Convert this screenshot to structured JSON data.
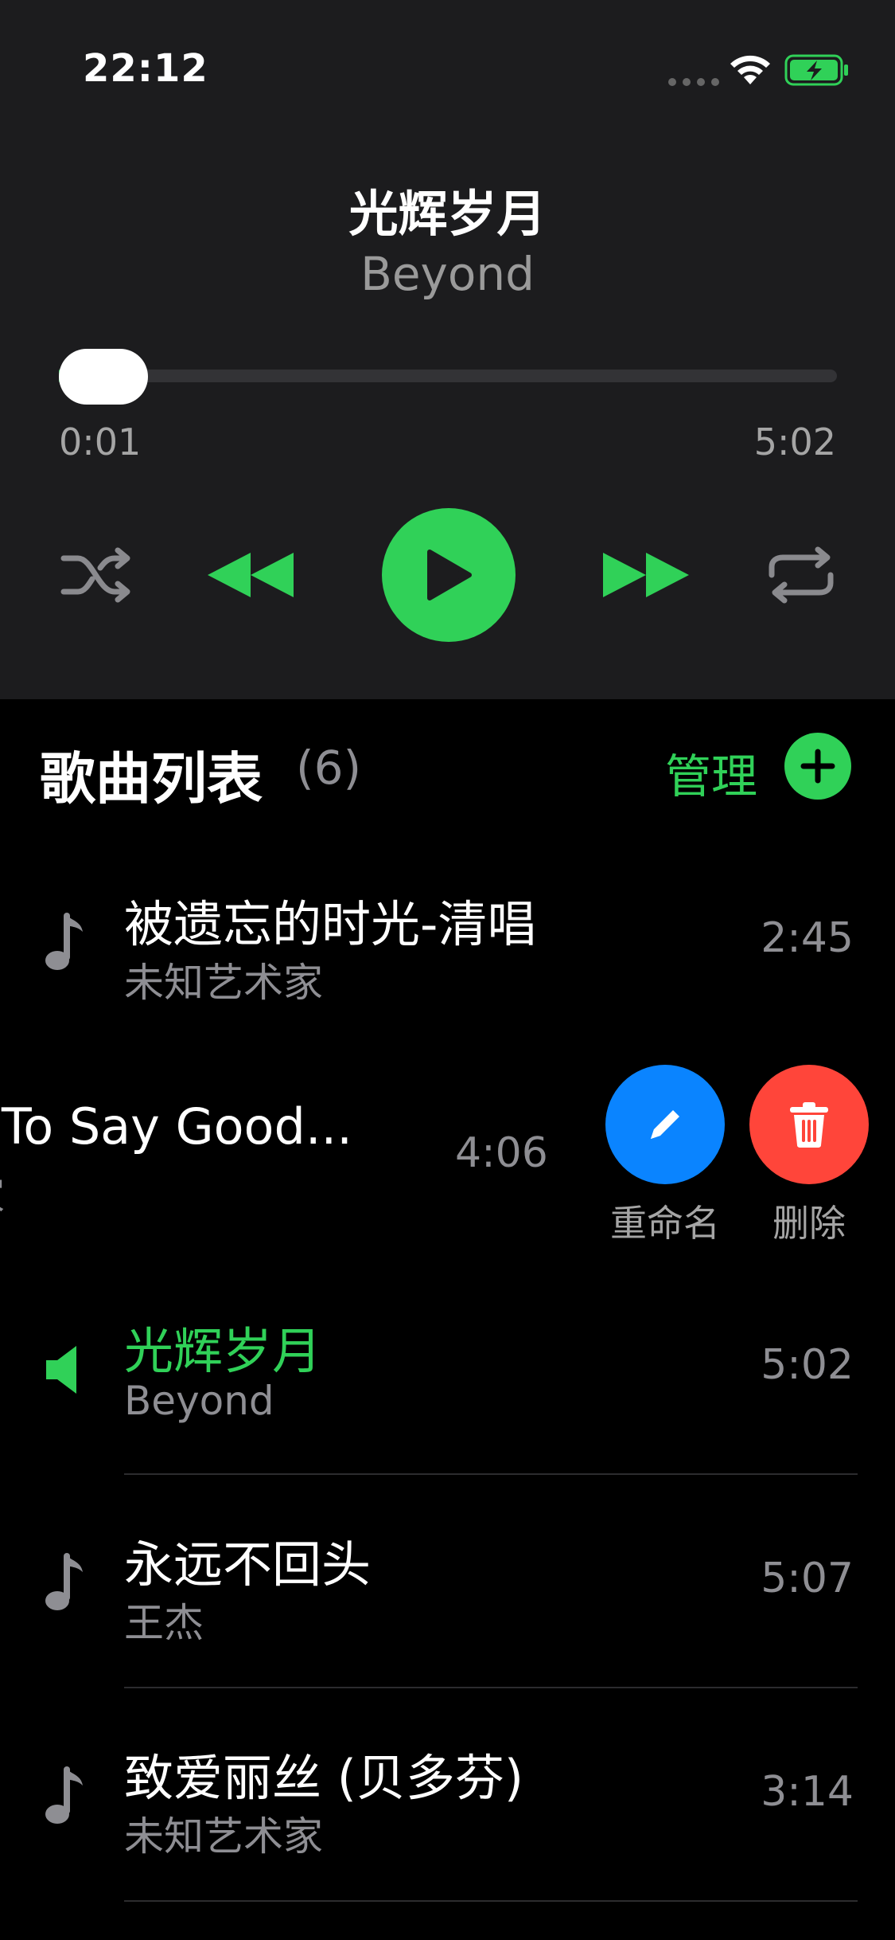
{
  "status": {
    "time": "22:12"
  },
  "player": {
    "title": "光辉岁月",
    "artist": "Beyond",
    "elapsed": "0:01",
    "total": "5:02",
    "progress": 0.003,
    "accent_color": "#30d158",
    "controls": [
      "shuffle-icon",
      "previous-icon",
      "play-icon",
      "next-icon",
      "repeat-icon"
    ]
  },
  "list": {
    "title": "歌曲列表",
    "count": "(6)",
    "manage_label": "管理",
    "songs": [
      {
        "title": "被遗忘的时光-清唱",
        "artist": "未知艺术家",
        "duration": "2:45",
        "icon": "music-note-icon",
        "active": false
      },
      {
        "title": "e To Say Good...",
        "artist": "家",
        "duration": "4:06",
        "icon": "music-note-icon",
        "active": false,
        "swiped": true
      },
      {
        "title": "光辉岁月",
        "artist": "Beyond",
        "duration": "5:02",
        "icon": "speaker-icon",
        "active": true
      },
      {
        "title": "永远不回头",
        "artist": "王杰",
        "duration": "5:07",
        "icon": "music-note-icon",
        "active": false
      },
      {
        "title": "致爱丽丝 (贝多芬)",
        "artist": "未知艺术家",
        "duration": "3:14",
        "icon": "music-note-icon",
        "active": false
      }
    ],
    "actions": {
      "rename_label": "重命名",
      "delete_label": "删除",
      "rename_color": "#0a84ff",
      "delete_color": "#ff453a"
    }
  }
}
